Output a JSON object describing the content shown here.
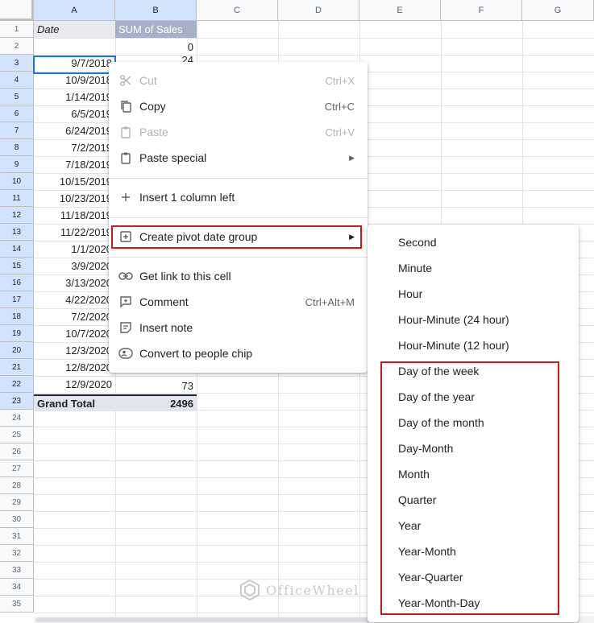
{
  "sheet": {
    "columns": [
      "A",
      "B",
      "C",
      "D",
      "E",
      "F",
      "G"
    ],
    "rows": [
      "1",
      "2",
      "3",
      "4",
      "5",
      "6",
      "7",
      "8",
      "9",
      "10",
      "11",
      "12",
      "13",
      "14",
      "15",
      "16",
      "17",
      "18",
      "19",
      "20",
      "21",
      "22",
      "23",
      "24",
      "25",
      "26",
      "27",
      "28",
      "29",
      "30",
      "31",
      "32",
      "33",
      "34",
      "35"
    ],
    "header_date": "Date",
    "header_sales": "SUM of Sales",
    "row2_value": "0",
    "row3_value_partial": "24",
    "dates": [
      "9/7/2018",
      "10/9/2018",
      "1/14/2019",
      "6/5/2019",
      "6/24/2019",
      "7/2/2019",
      "7/18/2019",
      "10/15/2019",
      "10/23/2019",
      "11/18/2019",
      "11/22/2019",
      "1/1/2020",
      "3/9/2020",
      "3/13/2020",
      "4/22/2020",
      "7/2/2020",
      "10/7/2020",
      "12/3/2020",
      "12/8/2020",
      "12/9/2020"
    ],
    "row22_value": "73",
    "grand_total_label": "Grand Total",
    "grand_total_value": "2496",
    "colors": {
      "selection": "#1a73e8",
      "header_sales_bg": "#a6b1c9",
      "highlight": "#d0181c"
    }
  },
  "context_menu": {
    "cut": {
      "label": "Cut",
      "shortcut": "Ctrl+X",
      "icon": "scissors-icon",
      "disabled": true
    },
    "copy": {
      "label": "Copy",
      "shortcut": "Ctrl+C",
      "icon": "copy-icon"
    },
    "paste": {
      "label": "Paste",
      "shortcut": "Ctrl+V",
      "icon": "clipboard-icon",
      "disabled": true
    },
    "paste_special": {
      "label": "Paste special",
      "icon": "clipboard-icon"
    },
    "insert_column": {
      "label": "Insert 1 column left",
      "icon": "plus-icon"
    },
    "pivot_date_group": {
      "label": "Create pivot date group",
      "icon": "plus-box-icon"
    },
    "get_link": {
      "label": "Get link to this cell",
      "icon": "link-icon"
    },
    "comment": {
      "label": "Comment",
      "shortcut": "Ctrl+Alt+M",
      "icon": "comment-icon"
    },
    "insert_note": {
      "label": "Insert note",
      "icon": "note-icon"
    },
    "people_chip": {
      "label": "Convert to people chip",
      "icon": "person-chip-icon"
    }
  },
  "submenu": {
    "items": [
      "Second",
      "Minute",
      "Hour",
      "Hour-Minute (24 hour)",
      "Hour-Minute (12 hour)",
      "Day of the week",
      "Day of the year",
      "Day of the month",
      "Day-Month",
      "Month",
      "Quarter",
      "Year",
      "Year-Month",
      "Year-Quarter",
      "Year-Month-Day"
    ]
  },
  "watermark": {
    "text": "OfficeWheel"
  }
}
